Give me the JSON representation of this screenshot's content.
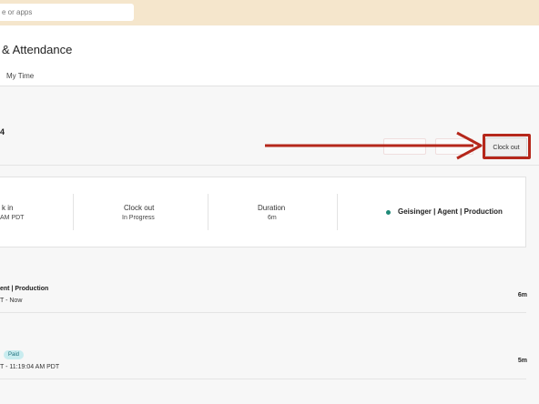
{
  "topbar": {
    "search_placeholder": "e or apps"
  },
  "header": {
    "title": "& Attendance",
    "tab": "My Time"
  },
  "week": {
    "label_fragment": "4"
  },
  "toolbar": {
    "clock_out_label": "Clock out"
  },
  "card": {
    "clock_in_label": "k in",
    "clock_in_value": "AM PDT",
    "clock_out_label": "Clock out",
    "clock_out_value": "In Progress",
    "duration_label": "Duration",
    "duration_value": "6m",
    "project": "Geisinger | Agent | Production",
    "status_color": "#1f8a78"
  },
  "entries": [
    {
      "title": "ent | Production",
      "time": "T - Now",
      "duration": "6m"
    },
    {
      "badge": "Paid",
      "time": "T - 11:19:04 AM PDT",
      "duration": "5m"
    }
  ],
  "annotation": {
    "color": "#b5271b"
  }
}
